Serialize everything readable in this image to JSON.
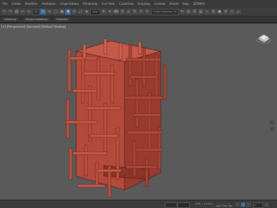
{
  "menu": {
    "items": [
      "File",
      "Create",
      "Modifiers",
      "Animation",
      "Graph Editors",
      "Rendering",
      "Civil View",
      "Customize",
      "Scripting",
      "Content",
      "Arnold",
      "Help",
      "3DSMAX"
    ]
  },
  "toolbar": {
    "selection_filter": "All",
    "named_selection": "Create Selection Se"
  },
  "ribbon": {
    "tabs": [
      "Modeling",
      "Polygon Modeling",
      "Freeform"
    ]
  },
  "viewport": {
    "label": "[+] [Perspective] [Standard] [Default Shading]",
    "accent_color": "#b84a3a"
  },
  "status": {
    "grid_text": "Grid = 10.0cm",
    "add_time_tag": "Add Time Tag",
    "frame_value": "0"
  }
}
